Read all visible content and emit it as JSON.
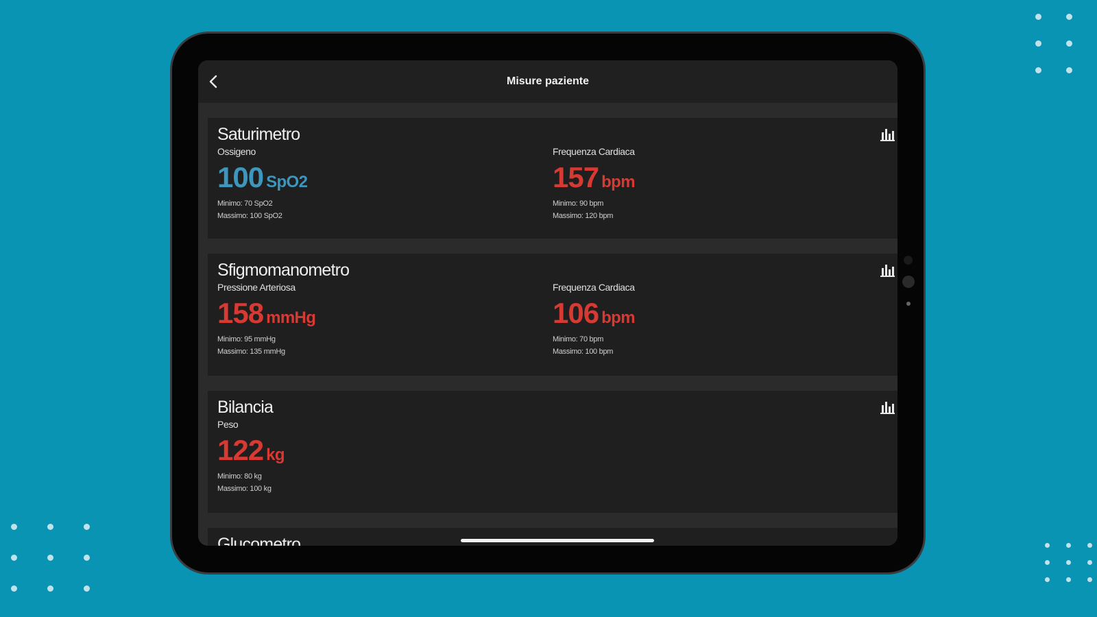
{
  "app": {
    "title": "Misure paziente"
  },
  "colors": {
    "background": "#0994b3",
    "normal": "#3e96bd",
    "alert": "#d73a33",
    "card": "#1f1f1f"
  },
  "icons": {
    "back": "chevron-left-icon",
    "chart": "bar-chart-icon"
  },
  "cards": [
    {
      "device": "Saturimetro",
      "measures": [
        {
          "label": "Ossigeno",
          "value": "100",
          "unit": "SpO2",
          "status": "normal",
          "min": "Minimo: 70 SpO2",
          "max": "Massimo: 100 SpO2"
        },
        {
          "label": "Frequenza Cardiaca",
          "value": "157",
          "unit": "bpm",
          "status": "alert",
          "min": "Minimo: 90 bpm",
          "max": "Massimo: 120 bpm"
        }
      ]
    },
    {
      "device": "Sfigmomanometro",
      "measures": [
        {
          "label": "Pressione Arteriosa",
          "value": "158",
          "unit": "mmHg",
          "status": "alert",
          "min": "Minimo: 95 mmHg",
          "max": "Massimo: 135 mmHg"
        },
        {
          "label": "Frequenza Cardiaca",
          "value": "106",
          "unit": "bpm",
          "status": "alert",
          "min": "Minimo: 70 bpm",
          "max": "Massimo: 100 bpm"
        }
      ]
    },
    {
      "device": "Bilancia",
      "measures": [
        {
          "label": "Peso",
          "value": "122",
          "unit": "kg",
          "status": "alert",
          "min": "Minimo: 80 kg",
          "max": "Massimo: 100 kg"
        }
      ]
    },
    {
      "device": "Glucometro",
      "measures": []
    }
  ]
}
